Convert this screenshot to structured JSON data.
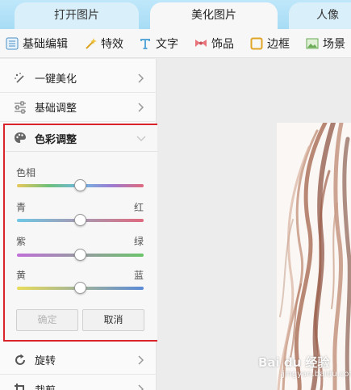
{
  "tabs": [
    {
      "label": "打开图片",
      "active": false
    },
    {
      "label": "美化图片",
      "active": true
    },
    {
      "label": "人像",
      "active": false
    }
  ],
  "toolbar": [
    {
      "label": "基础编辑",
      "icon": "basic-edit-icon",
      "active": true
    },
    {
      "label": "特效",
      "icon": "magic-wand-icon"
    },
    {
      "label": "文字",
      "icon": "text-t-icon"
    },
    {
      "label": "饰品",
      "icon": "bow-icon"
    },
    {
      "label": "边框",
      "icon": "frame-icon"
    },
    {
      "label": "场景",
      "icon": "scene-icon"
    }
  ],
  "panel": {
    "items_top": [
      {
        "label": "一键美化",
        "icon": "magic-stars-icon"
      },
      {
        "label": "基础调整",
        "icon": "sliders-icon"
      }
    ],
    "color_adjust": {
      "title": "色彩调整",
      "icon": "palette-icon",
      "expanded": true,
      "sliders": [
        {
          "left_label": "色相",
          "right_label": "",
          "value": 0.5,
          "gradient": [
            "#e8c85a",
            "#6ec07a",
            "#6fb7e3",
            "#9c7bd1",
            "#e06a7e"
          ]
        },
        {
          "left_label": "青",
          "right_label": "红",
          "value": 0.5,
          "gradient": [
            "#6ec8e6",
            "#e06a7e"
          ]
        },
        {
          "left_label": "紫",
          "right_label": "绿",
          "value": 0.5,
          "gradient": [
            "#c070d8",
            "#6cc46c"
          ]
        },
        {
          "left_label": "黄",
          "right_label": "蓝",
          "value": 0.5,
          "gradient": [
            "#e8dc5a",
            "#5a8ad8"
          ]
        }
      ],
      "confirm_label": "确定",
      "cancel_label": "取消"
    },
    "items_bottom": [
      {
        "label": "旋转",
        "icon": "rotate-icon"
      },
      {
        "label": "裁剪",
        "icon": "crop-icon"
      }
    ]
  },
  "watermark": {
    "text": "Bai du 经验",
    "sub": "jingyan.baidu.com"
  }
}
